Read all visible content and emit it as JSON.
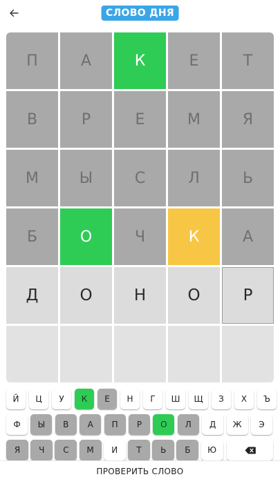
{
  "header": {
    "title": "СЛОВО ДНЯ",
    "back_icon": "arrow-left-icon",
    "title_color": "#3aa6e8"
  },
  "colors": {
    "correct": "#2ecc55",
    "present": "#f7c644",
    "absent": "#a9a9a9"
  },
  "board": {
    "rows": [
      [
        {
          "l": "П",
          "s": "absent"
        },
        {
          "l": "А",
          "s": "absent"
        },
        {
          "l": "К",
          "s": "correct"
        },
        {
          "l": "Е",
          "s": "absent"
        },
        {
          "l": "Т",
          "s": "absent"
        }
      ],
      [
        {
          "l": "В",
          "s": "absent"
        },
        {
          "l": "Р",
          "s": "absent"
        },
        {
          "l": "Е",
          "s": "absent"
        },
        {
          "l": "М",
          "s": "absent"
        },
        {
          "l": "Я",
          "s": "absent"
        }
      ],
      [
        {
          "l": "М",
          "s": "absent"
        },
        {
          "l": "Ы",
          "s": "absent"
        },
        {
          "l": "С",
          "s": "absent"
        },
        {
          "l": "Л",
          "s": "absent"
        },
        {
          "l": "Ь",
          "s": "absent"
        }
      ],
      [
        {
          "l": "Б",
          "s": "absent"
        },
        {
          "l": "О",
          "s": "correct"
        },
        {
          "l": "Ч",
          "s": "absent"
        },
        {
          "l": "К",
          "s": "present"
        },
        {
          "l": "А",
          "s": "absent"
        }
      ],
      [
        {
          "l": "Д",
          "s": "typed"
        },
        {
          "l": "О",
          "s": "typed"
        },
        {
          "l": "Н",
          "s": "typed"
        },
        {
          "l": "О",
          "s": "typed"
        },
        {
          "l": "Р",
          "s": "typed cursor"
        }
      ],
      [
        {
          "l": "",
          "s": "empty"
        },
        {
          "l": "",
          "s": "empty"
        },
        {
          "l": "",
          "s": "empty"
        },
        {
          "l": "",
          "s": "empty"
        },
        {
          "l": "",
          "s": "empty"
        }
      ]
    ]
  },
  "keyboard": {
    "rows": [
      [
        {
          "k": "Й",
          "s": ""
        },
        {
          "k": "Ц",
          "s": ""
        },
        {
          "k": "У",
          "s": ""
        },
        {
          "k": "К",
          "s": "correct"
        },
        {
          "k": "Е",
          "s": "absent"
        },
        {
          "k": "Н",
          "s": ""
        },
        {
          "k": "Г",
          "s": ""
        },
        {
          "k": "Ш",
          "s": ""
        },
        {
          "k": "Щ",
          "s": ""
        },
        {
          "k": "З",
          "s": ""
        },
        {
          "k": "Х",
          "s": ""
        },
        {
          "k": "Ъ",
          "s": ""
        }
      ],
      [
        {
          "k": "Ф",
          "s": ""
        },
        {
          "k": "Ы",
          "s": "absent"
        },
        {
          "k": "В",
          "s": "absent"
        },
        {
          "k": "А",
          "s": "absent"
        },
        {
          "k": "П",
          "s": "absent"
        },
        {
          "k": "Р",
          "s": "absent"
        },
        {
          "k": "О",
          "s": "correct"
        },
        {
          "k": "Л",
          "s": "absent"
        },
        {
          "k": "Д",
          "s": ""
        },
        {
          "k": "Ж",
          "s": ""
        },
        {
          "k": "Э",
          "s": ""
        }
      ],
      [
        {
          "k": "Я",
          "s": "absent"
        },
        {
          "k": "Ч",
          "s": "absent"
        },
        {
          "k": "С",
          "s": "absent"
        },
        {
          "k": "М",
          "s": "absent"
        },
        {
          "k": "И",
          "s": ""
        },
        {
          "k": "Т",
          "s": "absent"
        },
        {
          "k": "Ь",
          "s": "absent"
        },
        {
          "k": "Б",
          "s": "absent"
        },
        {
          "k": "Ю",
          "s": ""
        }
      ]
    ],
    "backspace_icon": "backspace-icon"
  },
  "footer": {
    "check_label": "ПРОВЕРИТЬ СЛОВО"
  }
}
